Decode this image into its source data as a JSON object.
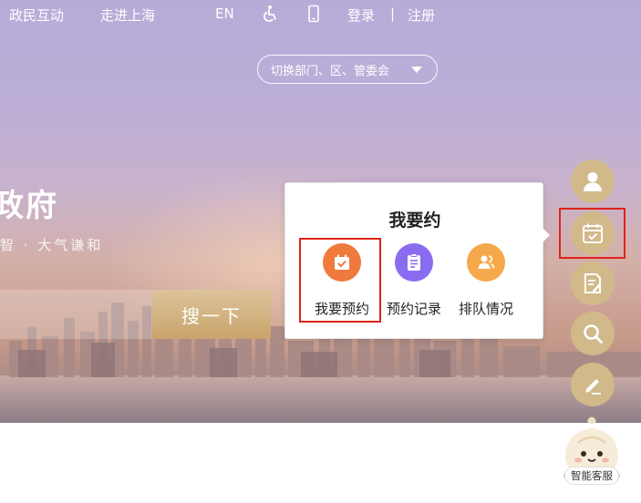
{
  "topnav": {
    "items": [
      "政民互动",
      "走进上海"
    ],
    "lang": "EN",
    "login": "登录",
    "separator": "|",
    "register": "注册"
  },
  "dept_switch": {
    "label": "切换部门、区、管委会"
  },
  "hero": {
    "title": "政府",
    "slogan": "智 · 大气谦和"
  },
  "search": {
    "button_label": "搜一下"
  },
  "popup": {
    "title": "我要约",
    "options": [
      {
        "label": "我要预约",
        "color": "#f07a3c"
      },
      {
        "label": "预约记录",
        "color": "#8a6cf0"
      },
      {
        "label": "排队情况",
        "color": "#f6a94a"
      }
    ]
  },
  "sidebar": {
    "buttons": [
      "user-icon",
      "calendar-check-icon",
      "document-edit-icon",
      "search-icon",
      "pencil-icon"
    ],
    "accent": "#d1b98a"
  },
  "bot": {
    "label": "智能客服"
  },
  "highlight_color": "#e0231a"
}
